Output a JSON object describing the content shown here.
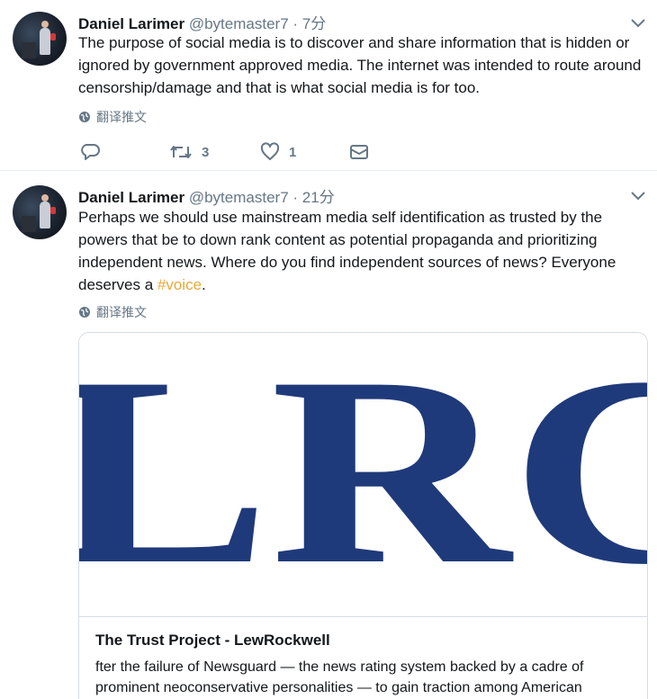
{
  "tweets": [
    {
      "name": "Daniel Larimer",
      "handle": "@bytemaster7",
      "separator": "·",
      "time": "7分",
      "text": "The purpose of social media is to discover and share information that is hidden or ignored by government approved media. The internet was intended to route around censorship/damage and that is what social media is for too.",
      "translate": "翻译推文",
      "actions": {
        "reply_count": "",
        "retweet_count": "3",
        "like_count": "1"
      }
    },
    {
      "name": "Daniel Larimer",
      "handle": "@bytemaster7",
      "separator": "·",
      "time": "21分",
      "text_before": "Perhaps we should use mainstream media self identification as trusted by the powers that be to down rank content as potential propaganda and prioritizing independent news. Where do you find independent sources of news? Everyone deserves a ",
      "hashtag": "#voice",
      "text_after": ".",
      "translate": "翻译推文",
      "card": {
        "image_text": "LRC",
        "title": "The Trust Project - LewRockwell",
        "description": "fter the failure of Newsguard — the news rating system backed by a cadre of prominent neoconservative personalities — to gain traction among American"
      }
    }
  ],
  "icons": {
    "caret": "chevron-down-icon",
    "globe": "globe-icon",
    "reply": "reply-icon",
    "retweet": "retweet-icon",
    "like": "heart-icon",
    "dm": "envelope-icon"
  },
  "colors": {
    "hashtag": "#e8a93a",
    "logo": "#1f3a7a",
    "secondary_text": "#657786"
  }
}
